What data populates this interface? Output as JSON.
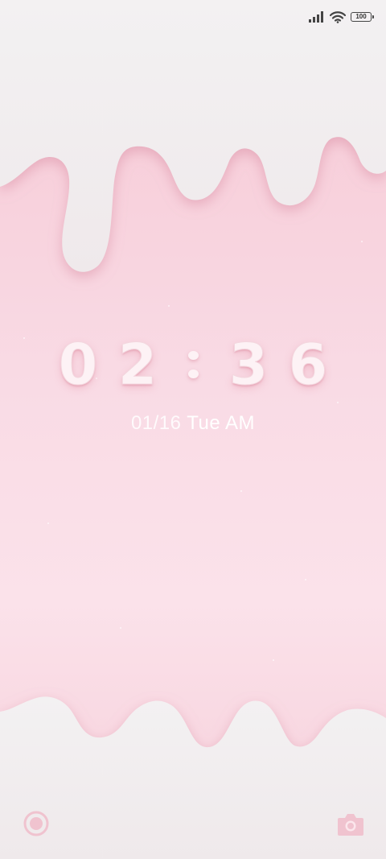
{
  "status_bar": {
    "signal_icon": "signal-bars-icon",
    "wifi_icon": "wifi-icon",
    "battery_icon": "battery-icon",
    "battery_level": "100"
  },
  "lockscreen": {
    "clock": {
      "hour_tens": "0",
      "hour_ones": "2",
      "minute_tens": "3",
      "minute_ones": "6"
    },
    "date": "01/16",
    "day_of_week": "Tue",
    "meridiem": "AM"
  },
  "shortcuts": {
    "left_icon": "assistant-circle-icon",
    "right_icon": "camera-icon"
  },
  "colors": {
    "pink_background": "#f9dbe5",
    "cream_drip": "#f4f2f3",
    "clock_text": "#fdf2f5"
  }
}
